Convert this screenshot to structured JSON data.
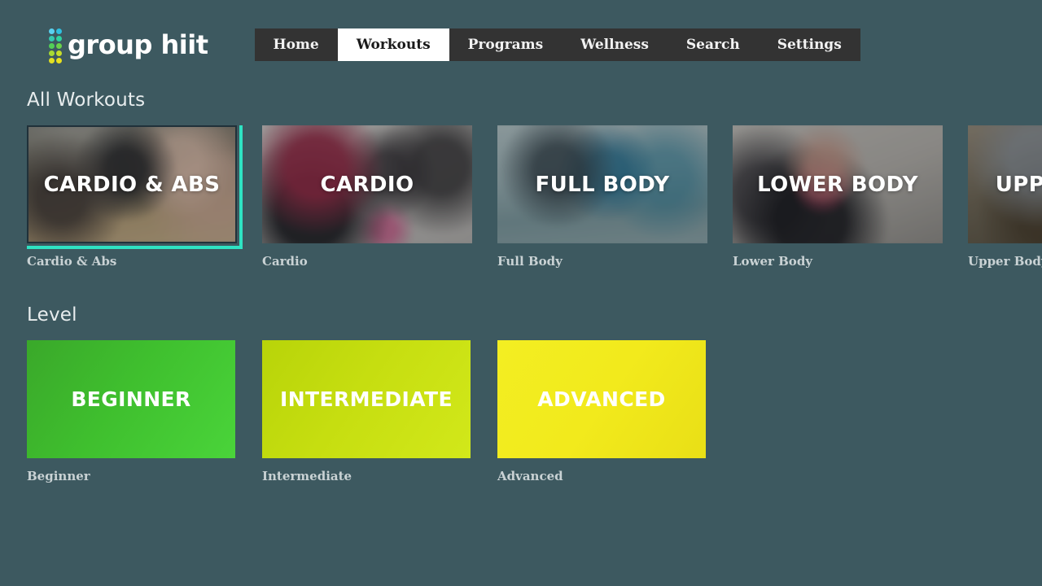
{
  "brand": {
    "name": "group hiit",
    "dot_colors": [
      "#5ad1f0",
      "#2fbfe0",
      "#35c9b0",
      "#2fd3a0",
      "#52cf56",
      "#6ad24a",
      "#a8da33",
      "#c6dd2a",
      "#e2e022",
      "#e8e01e"
    ]
  },
  "nav": {
    "items": [
      {
        "label": "Home",
        "active": false
      },
      {
        "label": "Workouts",
        "active": true
      },
      {
        "label": "Programs",
        "active": false
      },
      {
        "label": "Wellness",
        "active": false
      },
      {
        "label": "Search",
        "active": false
      },
      {
        "label": "Settings",
        "active": false
      }
    ]
  },
  "sections": [
    {
      "title": "All Workouts",
      "cards": [
        {
          "tile_label": "CARDIO & ABS",
          "caption": "Cardio & Abs",
          "art": "art-cardio-abs",
          "focused": true
        },
        {
          "tile_label": "CARDIO",
          "caption": "Cardio",
          "art": "art-cardio",
          "focused": false
        },
        {
          "tile_label": "FULL BODY",
          "caption": "Full Body",
          "art": "art-full-body",
          "focused": false
        },
        {
          "tile_label": "LOWER BODY",
          "caption": "Lower Body",
          "art": "art-lower-body",
          "focused": false
        },
        {
          "tile_label": "UPPER BODY",
          "caption": "Upper Body",
          "art": "art-upper-body",
          "focused": false
        }
      ]
    },
    {
      "title": "Level",
      "cards": [
        {
          "tile_label": "BEGINNER",
          "caption": "Beginner",
          "grad": "grad-beginner",
          "focused": false
        },
        {
          "tile_label": "INTERMEDIATE",
          "caption": "Intermediate",
          "grad": "grad-intermediate",
          "focused": false
        },
        {
          "tile_label": "ADVANCED",
          "caption": "Advanced",
          "grad": "grad-advanced",
          "focused": false
        }
      ]
    }
  ],
  "colors": {
    "page_background": "#3d5960",
    "nav_background": "#333333",
    "nav_active_background": "#ffffff",
    "focus_ring": "#2fe3c3",
    "caption_text": "#c9d2d4",
    "section_title_text": "#e8edee"
  }
}
